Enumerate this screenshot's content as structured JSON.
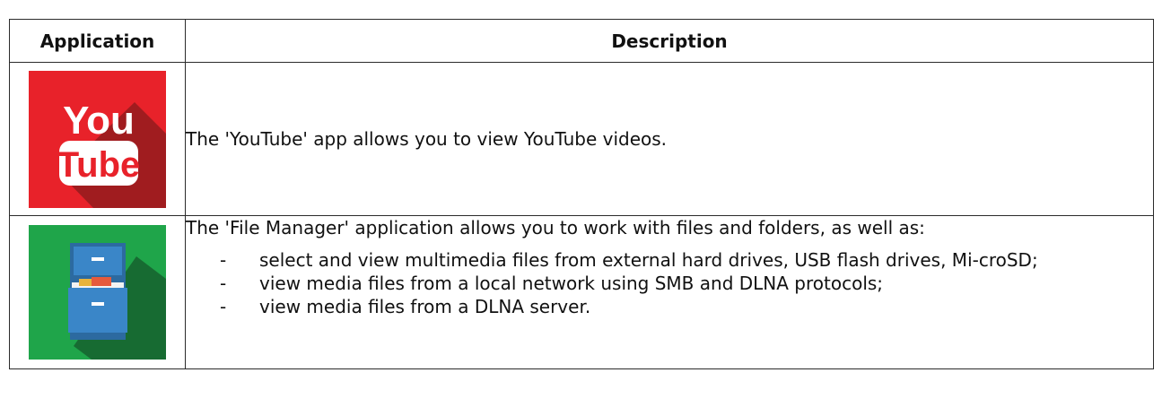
{
  "table": {
    "headers": {
      "application": "Application",
      "description": "Description"
    },
    "rows": [
      {
        "icon": "youtube-icon",
        "icon_text_top": "You",
        "icon_text_bottom": "Tube",
        "description": "The 'YouTube' app allows you to view YouTube videos."
      },
      {
        "icon": "file-manager-icon",
        "intro": "The 'File Manager' application allows you to work with files and folders, as well as:",
        "items": [
          "select and view multimedia files from external hard drives, USB flash drives, Mi-croSD;",
          "view media files from a local network using SMB and DLNA protocols;",
          "view media files from a DLNA server."
        ],
        "bullet": "-"
      }
    ]
  },
  "colors": {
    "youtube_red": "#e8222a",
    "youtube_shadow": "#a01c1f",
    "file_manager_green": "#1fa54a",
    "file_manager_shadow": "#176b32",
    "cabinet_blue": "#3a86c8",
    "border": "#2b2b2b"
  }
}
